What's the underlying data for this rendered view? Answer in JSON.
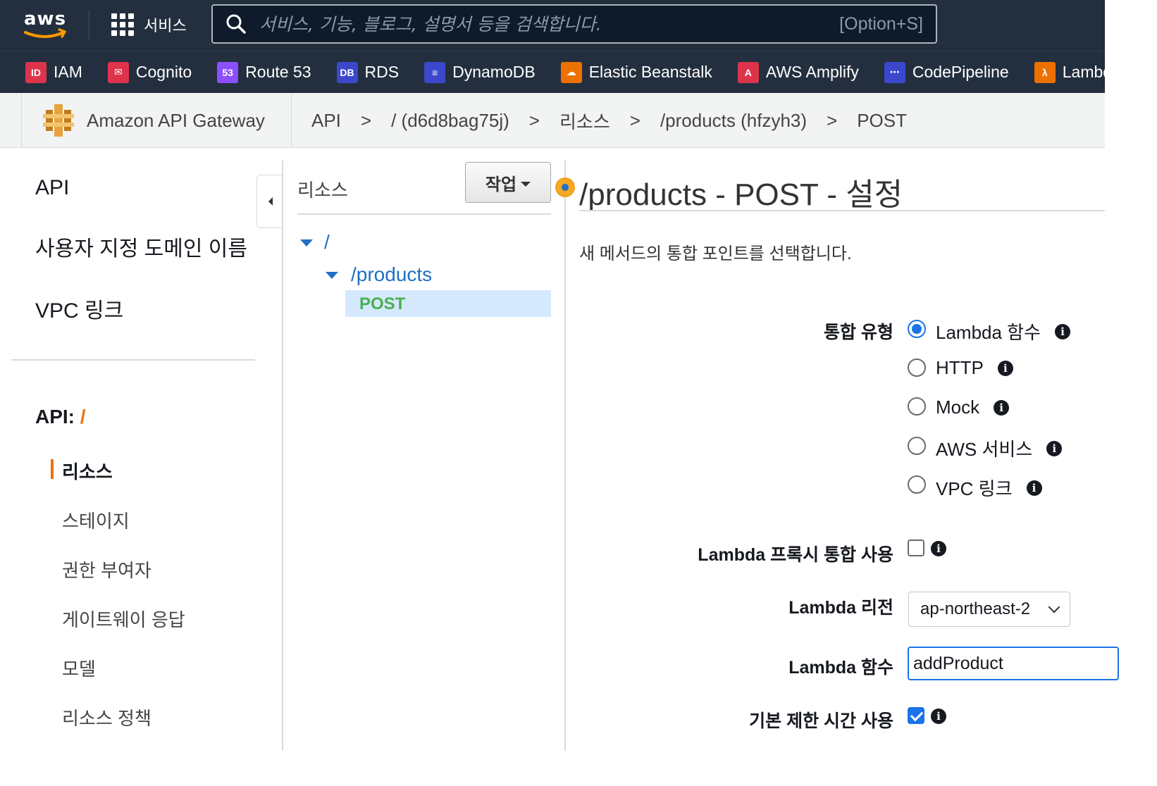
{
  "topnav": {
    "logo_text": "aws",
    "services_label": "서비스",
    "search_placeholder": "서비스, 기능, 블로그, 설명서 등을 검색합니다.",
    "search_shortcut": "[Option+S]"
  },
  "favorites": [
    {
      "label": "IAM",
      "icon": "iam-icon",
      "color": "#dd344c",
      "glyph": "ID"
    },
    {
      "label": "Cognito",
      "icon": "cognito-icon",
      "color": "#dd344c",
      "glyph": "✉"
    },
    {
      "label": "Route 53",
      "icon": "route53-icon",
      "color": "#8c4fff",
      "glyph": "53"
    },
    {
      "label": "RDS",
      "icon": "rds-icon",
      "color": "#3b48cc",
      "glyph": "DB"
    },
    {
      "label": "DynamoDB",
      "icon": "dynamodb-icon",
      "color": "#3b48cc",
      "glyph": "≡"
    },
    {
      "label": "Elastic Beanstalk",
      "icon": "beanstalk-icon",
      "color": "#ed7100",
      "glyph": "☁"
    },
    {
      "label": "AWS Amplify",
      "icon": "amplify-icon",
      "color": "#dd344c",
      "glyph": "A"
    },
    {
      "label": "CodePipeline",
      "icon": "codepipeline-icon",
      "color": "#3b48cc",
      "glyph": "⋯"
    },
    {
      "label": "Lambda",
      "icon": "lambda-icon",
      "color": "#ed7100",
      "glyph": "λ"
    }
  ],
  "breadcrumb": {
    "service": "Amazon API Gateway",
    "items": [
      "API",
      "/ (d6d8bag75j)",
      "리소스",
      "/products (hfzyh3)",
      "POST"
    ],
    "separator": ">"
  },
  "sidebar": {
    "top_items": [
      "API",
      "사용자 지정 도메인 이름",
      "VPC 링크"
    ],
    "api_label": "API:",
    "api_name": "/",
    "sub_items": [
      "리소스",
      "스테이지",
      "권한 부여자",
      "게이트웨이 응답",
      "모델",
      "리소스 정책"
    ],
    "active_index": 0
  },
  "resources": {
    "title": "리소스",
    "action_label": "작업",
    "tree": {
      "root": "/",
      "child": "/products",
      "method": "POST"
    }
  },
  "main": {
    "title": "/products - POST - 설정",
    "description": "새 메서드의 통합 포인트를 선택합니다.",
    "integration_type_label": "통합 유형",
    "integration_types": [
      "Lambda 함수",
      "HTTP",
      "Mock",
      "AWS 서비스",
      "VPC 링크"
    ],
    "integration_selected": 0,
    "proxy_label": "Lambda 프록시 통합 사용",
    "proxy_checked": false,
    "region_label": "Lambda 리전",
    "region_value": "ap-northeast-2",
    "function_label": "Lambda 함수",
    "function_value": "addProduct",
    "timeout_label": "기본 제한 시간 사용",
    "timeout_checked": true,
    "colors": {
      "accent": "#1a73e8",
      "link": "#1f6fc5",
      "method_green": "#4caf50",
      "active_orange": "#ec7211",
      "nav_bg": "#232f3e"
    }
  }
}
